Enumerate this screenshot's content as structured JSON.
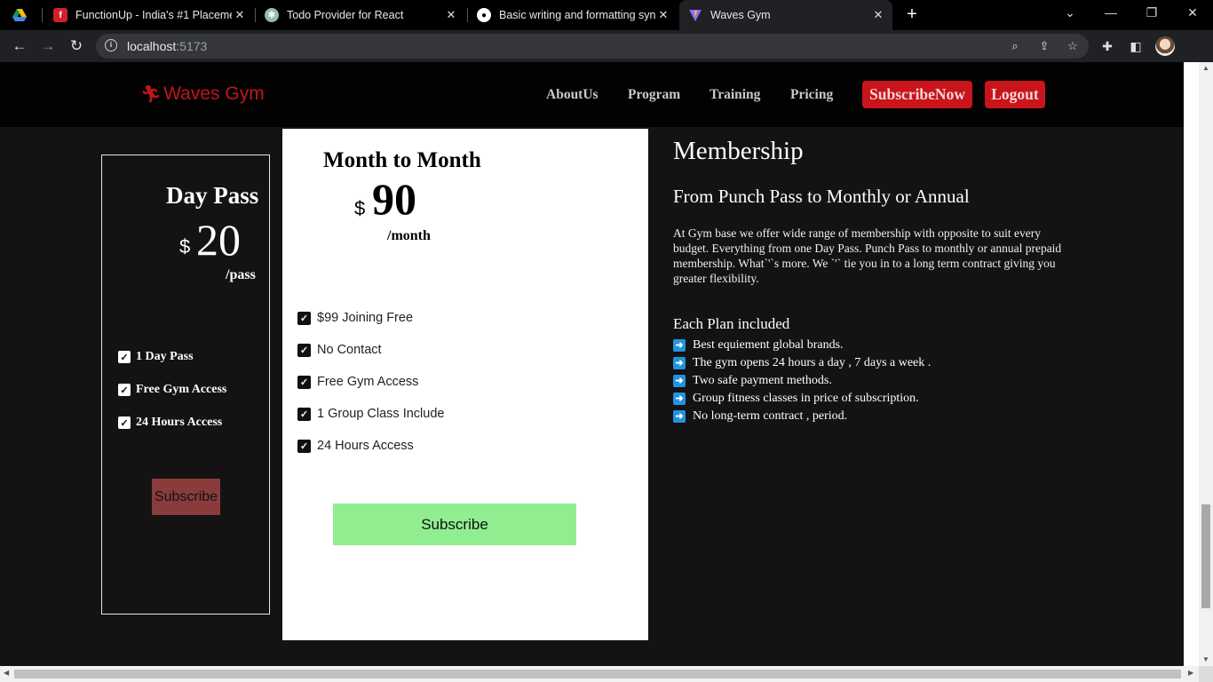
{
  "browser": {
    "tabs": [
      {
        "title": "",
        "favicon": "google-drive-icon"
      },
      {
        "title": "FunctionUp - India's #1 Placemen",
        "favicon": "functionup-icon"
      },
      {
        "title": "Todo Provider for React",
        "favicon": "chatgpt-icon"
      },
      {
        "title": "Basic writing and formatting synt",
        "favicon": "github-icon"
      },
      {
        "title": "Waves Gym",
        "favicon": "vite-icon",
        "active": true
      }
    ],
    "url_host": "localhost",
    "url_port": ":5173"
  },
  "nav": {
    "logo": "Waves Gym",
    "links": [
      "AboutUs",
      "Program",
      "Training",
      "Pricing"
    ],
    "subscribe_now": "SubscribeNow",
    "logout": "Logout"
  },
  "day_pass": {
    "title": "Day Pass",
    "currency": "$",
    "price": "20",
    "period": "/pass",
    "features": [
      "1 Day Pass",
      "Free Gym Access",
      "24 Hours Access"
    ],
    "button": "Subscribe"
  },
  "month_plan": {
    "title": "Month to Month",
    "currency": "$",
    "price": "90",
    "period": "/month",
    "features": [
      "$99 Joining Free",
      "No Contact",
      "Free Gym Access",
      "1 Group Class Include",
      "24 Hours Access"
    ],
    "button": "Subscribe"
  },
  "membership": {
    "heading": "Membership",
    "subheading": "From Punch Pass to Monthly or Annual",
    "description": "At Gym base we offer wide range of membership with opposite to suit every budget. Everything from one Day Pass. Punch Pass to monthly or annual prepaid membership. What`'`s more. We `'` tie you in to a long term contract giving you greater flexibility.",
    "plan_heading": "Each Plan included",
    "plan_items": [
      "Best equiement global brands.",
      "The gym opens 24 hours a day , 7 days a week .",
      "Two safe payment methods.",
      "Group fitness classes in price of subscription.",
      "No long-term contract , period."
    ]
  },
  "colors": {
    "brand": "#c0161b",
    "accent_green": "#90ee90",
    "day_button": "#8a3c3c",
    "list_arrow": "#1f95e0"
  }
}
